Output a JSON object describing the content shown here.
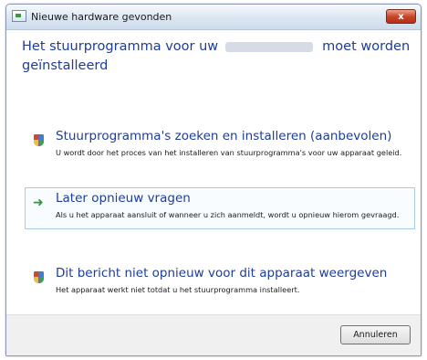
{
  "window": {
    "title": "Nieuwe hardware gevonden",
    "close_label": "x",
    "icons": {
      "app": "hardware-icon",
      "close": "close-icon"
    }
  },
  "heading": {
    "prefix": "Het stuurprogramma voor uw",
    "suffix": "moet worden geïnstalleerd"
  },
  "options": [
    {
      "icon": "shield-icon",
      "title": "Stuurprogramma's zoeken en installeren (aanbevolen)",
      "description": "U wordt door het proces van het installeren van stuurprogramma's voor uw apparaat geleid."
    },
    {
      "icon": "arrow-right-icon",
      "title": "Later opnieuw vragen",
      "description": "Als u het apparaat aansluit of wanneer u zich aanmeldt, wordt u opnieuw hierom gevraagd.",
      "selected": true
    },
    {
      "icon": "shield-icon",
      "title": "Dit bericht niet opnieuw voor dit apparaat weergeven",
      "description": "Het apparaat werkt niet totdat u het stuurprogramma installeert."
    }
  ],
  "footer": {
    "cancel_label": "Annuleren"
  },
  "colors": {
    "heading": "#1e3d9a",
    "close": "#c9462a",
    "selection_border": "#a9cbe6"
  }
}
